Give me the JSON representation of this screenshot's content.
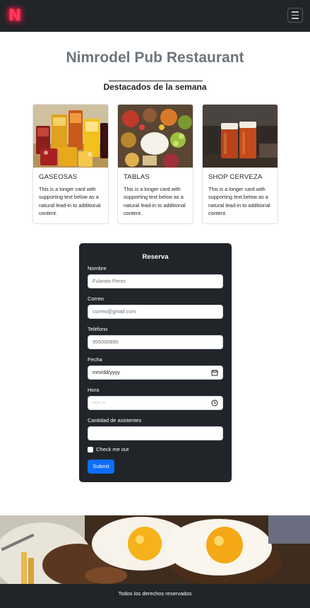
{
  "navbar": {
    "logo_letter": "N"
  },
  "page": {
    "title": "Nimrodel Pub Restaurant",
    "subtitle": "Destacados de la semana"
  },
  "cards": [
    {
      "title": "GASEOSAS",
      "text": "This is a longer card with supporting text below as a natural lead-in to additional content."
    },
    {
      "title": "TABLAS",
      "text": "This is a longer card with supporting text below as a natural lead-in to additional content."
    },
    {
      "title": "SHOP CERVEZA",
      "text": "This is a longer card with supporting text below as a natural lead-in to additional content."
    }
  ],
  "form": {
    "title": "Reserva",
    "nombre_label": "Nombre",
    "nombre_placeholder": "Fulanito Perez",
    "correo_label": "Correo",
    "correo_placeholder": "correo@gmail.com",
    "telefono_label": "Teléfono",
    "telefono_placeholder": "956000890",
    "fecha_label": "Fecha",
    "fecha_placeholder": "mm/dd/yyyy",
    "hora_label": "Hora",
    "hora_placeholder": "--:-- --",
    "asistentes_label": "Cantidad de asistentes",
    "check_label": "Check me out",
    "submit_label": "Submit"
  },
  "footer": {
    "text": "Todos los derechos reservados"
  },
  "colors": {
    "navbar": "#212529",
    "accent": "#0d6efd",
    "logo": "#ff3b5c"
  }
}
